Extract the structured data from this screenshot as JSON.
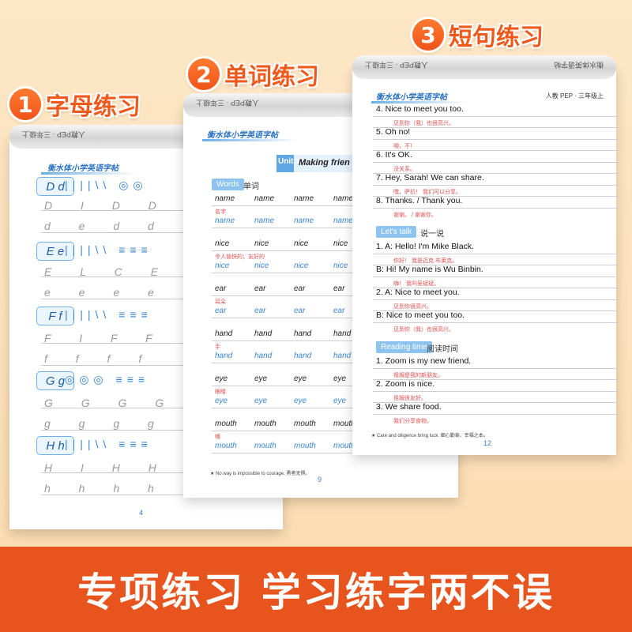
{
  "headings": [
    {
      "num": "1",
      "text": "字母练习"
    },
    {
      "num": "2",
      "text": "单词练习"
    },
    {
      "num": "3",
      "text": "短句练习"
    }
  ],
  "brand": "衡水体小学英语字帖",
  "roll_text_a": "人教PEP · 三年级上",
  "roll_text_b": "衡水体英语字帖",
  "page1": {
    "letters": [
      {
        "box": "D d",
        "strokes": "||||\\\\ ◎◎",
        "trace": "D I D D",
        "lower": "d e d d"
      },
      {
        "box": "E e",
        "strokes": "||||\\\\ ≡≡≡",
        "trace": "E L C E",
        "lower": "e e e e"
      },
      {
        "box": "F f",
        "strokes": "||||\\\\ ≡≡≡",
        "trace": "F I F F",
        "lower": "f f f f"
      },
      {
        "box": "G g",
        "strokes": "◎◎◎ ≡≡≡",
        "trace": "G G G G",
        "lower": "g g g g"
      },
      {
        "box": "H h",
        "strokes": "||||\\\\ ≡≡≡",
        "trace": "H I H H",
        "lower": "h h h h"
      }
    ],
    "page_no": "4"
  },
  "page2": {
    "unit_no": "Unit 1",
    "unit_title": "Making frien",
    "words_tag": "Words",
    "words_cn": "单词",
    "rows": [
      {
        "w": [
          "name",
          "name",
          "name",
          "name"
        ],
        "cn": "名字"
      },
      {
        "w": [
          "nice",
          "nice",
          "nice",
          "nice"
        ],
        "cn": "令人愉快的；友好的"
      },
      {
        "w": [
          "ear",
          "ear",
          "ear",
          "ear"
        ],
        "cn": "耳朵"
      },
      {
        "w": [
          "hand",
          "hand",
          "hand",
          "hand"
        ],
        "cn": "手"
      },
      {
        "w": [
          "eye",
          "eye",
          "eye",
          "eye"
        ],
        "cn": "眼睛"
      },
      {
        "w": [
          "mouth",
          "mouth",
          "mouth",
          "mouth"
        ],
        "cn": "嘴"
      }
    ],
    "footer": "★ No way is impossible to courage. 勇者无惧。",
    "page_no": "9"
  },
  "page3": {
    "meta": "人教 PEP · 三年级上",
    "s_top": [
      {
        "t": "4. Nice to meet you too.",
        "cn": "见到你（我）也很高兴。"
      },
      {
        "t": "5. Oh no!",
        "cn": "噢，不！"
      },
      {
        "t": "6. It's OK.",
        "cn": "没关系。"
      },
      {
        "t": "7. Hey, Sarah! We can share.",
        "cn": "嘿，萨拉！    我们可以分享。"
      },
      {
        "t": "8. Thanks. / Thank you.",
        "cn": "谢谢。   /   谢谢你。"
      }
    ],
    "talk_tag": "Let's talk",
    "talk_cn": "说一说",
    "s_talk": [
      {
        "t": "1. A: Hello! I'm Mike Black.",
        "cn": "你好！  我是迈克·布莱克。"
      },
      {
        "t": "    B: Hi! My name is Wu Binbin.",
        "cn": "嗨！  我叫吴斌斌。"
      },
      {
        "t": "2. A: Nice to meet you.",
        "cn": "见到你很高兴。"
      },
      {
        "t": "    B: Nice to meet you too.",
        "cn": "见到你（我）也很高兴。"
      }
    ],
    "read_tag": "Reading time",
    "read_cn": "阅读时间",
    "s_read": [
      {
        "t": "1. Zoom is my new friend.",
        "cn": "祖姆是我的新朋友。"
      },
      {
        "t": "2. Zoom is nice.",
        "cn": "祖姆很友好。"
      },
      {
        "t": "3. We share food.",
        "cn": "我们分享食物。"
      }
    ],
    "footer": "★ Care and diligence bring luck. 细心勤奋，幸福之本。",
    "page_no": "12"
  },
  "banner": "专项练习 学习练字两不误"
}
